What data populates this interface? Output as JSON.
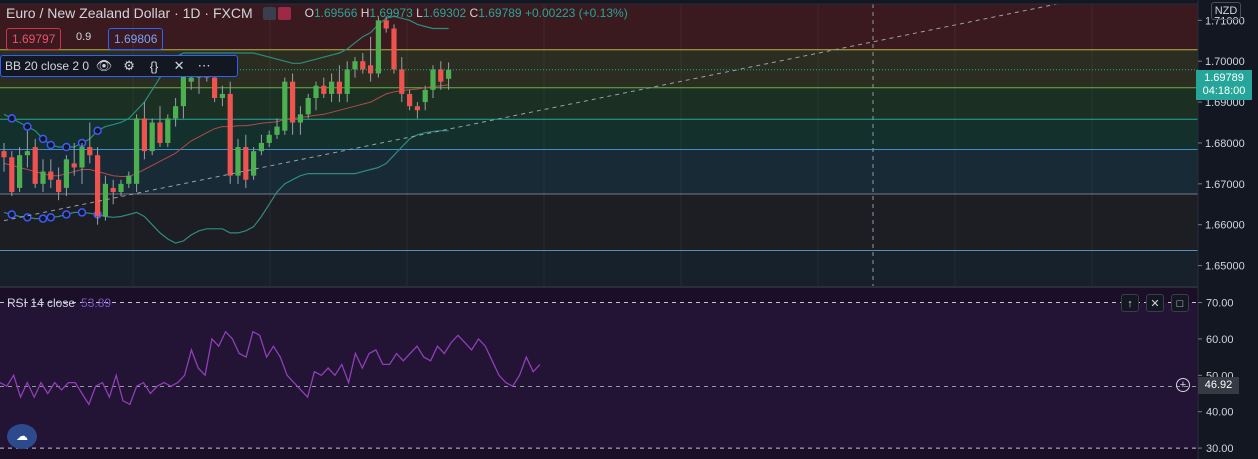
{
  "header": {
    "symbol": "Euro / New Zealand Dollar · 1D · FXCM",
    "open_label": "O",
    "open": "1.69566",
    "high_label": "H",
    "high": "1.69973",
    "low_label": "L",
    "low": "1.69302",
    "close_label": "C",
    "close": "1.69789",
    "change": "+0.00223 (+0.13%)"
  },
  "trade": {
    "sell": "1.69797",
    "spread": "0.9",
    "buy": "1.69806"
  },
  "indicator": {
    "label": "BB 20 close 2 0",
    "icons": [
      "eye-icon",
      "gear-icon",
      "braces-icon",
      "close-icon",
      "more-icon"
    ],
    "icon_glyphs": [
      "👁",
      "⚙",
      "{}",
      "✕",
      "⋯"
    ]
  },
  "axis": {
    "currency": "NZD",
    "price_ticks": [
      "1.71000",
      "1.70000",
      "1.69000",
      "1.68000",
      "1.67000",
      "1.66000",
      "1.65000"
    ],
    "last_price": "1.69789",
    "countdown": "04:18:00",
    "rsi_ticks": [
      "70.00",
      "60.00",
      "50.00",
      "40.00",
      "30.00"
    ],
    "rsi_crosshair": "46.92"
  },
  "rsi": {
    "label": "RSI 14 close",
    "value": "53.89",
    "buttons": [
      "↑",
      "✕",
      "□"
    ]
  },
  "logo": {
    "name": "tradingview-logo-icon"
  },
  "colors": {
    "up": "#26a69a",
    "down": "#ef5350",
    "bb": "#2e8b7f",
    "rsi": "#8e3fb4",
    "bg": "#131722",
    "rsi_bg": "#1a0f26"
  },
  "chart_data": [
    {
      "type": "candlestick",
      "title": "",
      "ylim": [
        1.645,
        1.714
      ],
      "ohlc": [
        [
          1.678,
          1.68,
          1.673,
          1.6765
        ],
        [
          1.6765,
          1.678,
          1.667,
          1.668
        ],
        [
          1.669,
          1.679,
          1.668,
          1.677
        ],
        [
          1.677,
          1.683,
          1.674,
          1.678
        ],
        [
          1.679,
          1.681,
          1.669,
          1.67
        ],
        [
          1.67,
          1.676,
          1.668,
          1.673
        ],
        [
          1.673,
          1.676,
          1.669,
          1.671
        ],
        [
          1.671,
          1.674,
          1.666,
          1.668
        ],
        [
          1.669,
          1.677,
          1.667,
          1.676
        ],
        [
          1.675,
          1.68,
          1.672,
          1.674
        ],
        [
          1.674,
          1.68,
          1.67,
          1.679
        ],
        [
          1.679,
          1.685,
          1.675,
          1.677
        ],
        [
          1.677,
          1.679,
          1.66,
          1.662
        ],
        [
          1.662,
          1.672,
          1.661,
          1.67
        ],
        [
          1.669,
          1.671,
          1.665,
          1.668
        ],
        [
          1.668,
          1.671,
          1.667,
          1.67
        ],
        [
          1.67,
          1.673,
          1.669,
          1.672
        ],
        [
          1.67,
          1.687,
          1.668,
          1.686
        ],
        [
          1.686,
          1.69,
          1.676,
          1.678
        ],
        [
          1.678,
          1.686,
          1.677,
          1.685
        ],
        [
          1.685,
          1.689,
          1.679,
          1.68
        ],
        [
          1.68,
          1.687,
          1.679,
          1.686
        ],
        [
          1.686,
          1.691,
          1.684,
          1.689
        ],
        [
          1.689,
          1.7,
          1.686,
          1.699
        ],
        [
          1.695,
          1.698,
          1.693,
          1.696
        ],
        [
          1.696,
          1.701,
          1.692,
          1.698
        ],
        [
          1.698,
          1.701,
          1.695,
          1.696
        ],
        [
          1.696,
          1.699,
          1.69,
          1.691
        ],
        [
          1.691,
          1.694,
          1.689,
          1.692
        ],
        [
          1.692,
          1.695,
          1.67,
          1.672
        ],
        [
          1.672,
          1.681,
          1.67,
          1.679
        ],
        [
          1.679,
          1.682,
          1.669,
          1.671
        ],
        [
          1.672,
          1.679,
          1.671,
          1.678
        ],
        [
          1.678,
          1.682,
          1.677,
          1.68
        ],
        [
          1.68,
          1.683,
          1.679,
          1.682
        ],
        [
          1.682,
          1.686,
          1.681,
          1.684
        ],
        [
          1.683,
          1.696,
          1.682,
          1.695
        ],
        [
          1.695,
          1.697,
          1.682,
          1.685
        ],
        [
          1.685,
          1.689,
          1.682,
          1.687
        ],
        [
          1.687,
          1.692,
          1.686,
          1.691
        ],
        [
          1.691,
          1.695,
          1.688,
          1.694
        ],
        [
          1.694,
          1.696,
          1.691,
          1.692
        ],
        [
          1.692,
          1.697,
          1.69,
          1.695
        ],
        [
          1.695,
          1.699,
          1.69,
          1.692
        ],
        [
          1.692,
          1.7,
          1.69,
          1.698
        ],
        [
          1.698,
          1.701,
          1.696,
          1.7
        ],
        [
          1.7,
          1.702,
          1.697,
          1.698
        ],
        [
          1.699,
          1.706,
          1.695,
          1.697
        ],
        [
          1.697,
          1.711,
          1.696,
          1.71
        ],
        [
          1.71,
          1.711,
          1.707,
          1.708
        ],
        [
          1.708,
          1.709,
          1.697,
          1.698
        ],
        [
          1.698,
          1.701,
          1.69,
          1.692
        ],
        [
          1.692,
          1.693,
          1.688,
          1.689
        ],
        [
          1.689,
          1.69,
          1.686,
          1.688
        ],
        [
          1.69,
          1.694,
          1.688,
          1.693
        ],
        [
          1.693,
          1.699,
          1.691,
          1.698
        ],
        [
          1.698,
          1.7,
          1.693,
          1.695
        ],
        [
          1.6957,
          1.6997,
          1.693,
          1.6979
        ]
      ],
      "bollinger_upper": [
        1.687,
        1.686,
        1.685,
        1.684,
        1.683,
        1.681,
        1.6795,
        1.679,
        1.679,
        1.679,
        1.68,
        1.681,
        1.683,
        1.684,
        1.6845,
        1.685,
        1.686,
        1.688,
        1.69,
        1.693,
        1.696,
        1.699,
        1.701,
        1.702,
        1.702,
        1.702,
        1.702,
        1.702,
        1.702,
        1.702,
        1.702,
        1.702,
        1.702,
        1.7015,
        1.701,
        1.7005,
        1.7,
        1.6995,
        1.6995,
        1.7,
        1.7005,
        1.701,
        1.7015,
        1.702,
        1.703,
        1.7045,
        1.706,
        1.707,
        1.709,
        1.7105,
        1.711,
        1.7105,
        1.71,
        1.709,
        1.7085,
        1.708,
        1.708,
        1.708
      ],
      "bollinger_middle": [
        1.675,
        1.6745,
        1.674,
        1.6735,
        1.673,
        1.6725,
        1.672,
        1.672,
        1.6725,
        1.673,
        1.6735,
        1.6735,
        1.673,
        1.6725,
        1.672,
        1.6718,
        1.6718,
        1.6725,
        1.6735,
        1.6745,
        1.6755,
        1.6765,
        1.6775,
        1.679,
        1.6805,
        1.6815,
        1.6825,
        1.6835,
        1.684,
        1.684,
        1.6842,
        1.6842,
        1.6845,
        1.6848,
        1.685,
        1.6852,
        1.6858,
        1.686,
        1.6862,
        1.6865,
        1.6868,
        1.687,
        1.6875,
        1.688,
        1.6885,
        1.689,
        1.6895,
        1.69,
        1.691,
        1.692,
        1.6925,
        1.6928,
        1.693,
        1.6932,
        1.6935,
        1.6938,
        1.694,
        1.6942
      ],
      "bollinger_lower": [
        1.663,
        1.6625,
        1.662,
        1.6618,
        1.6615,
        1.6615,
        1.6618,
        1.662,
        1.6625,
        1.663,
        1.663,
        1.6628,
        1.6625,
        1.662,
        1.6618,
        1.662,
        1.6625,
        1.663,
        1.662,
        1.66,
        1.658,
        1.6565,
        1.6555,
        1.656,
        1.6575,
        1.6585,
        1.659,
        1.659,
        1.659,
        1.658,
        1.658,
        1.6585,
        1.6595,
        1.662,
        1.665,
        1.668,
        1.67,
        1.671,
        1.672,
        1.6725,
        1.6725,
        1.6725,
        1.6725,
        1.6725,
        1.6725,
        1.6725,
        1.673,
        1.6735,
        1.674,
        1.675,
        1.677,
        1.679,
        1.681,
        1.682,
        1.6825,
        1.6828,
        1.683,
        1.683
      ],
      "bb_marker_index": [
        8,
        23,
        36,
        51,
        64,
        79,
        92
      ],
      "fib_levels": [
        1.7028,
        1.6935,
        1.6858,
        1.6784,
        1.6675,
        1.6537
      ],
      "trend_line": {
        "start": [
          0,
          1.661
        ],
        "end": [
          135,
          1.714
        ]
      },
      "crosshair_index": 105
    },
    {
      "type": "line",
      "title": "",
      "ylim": [
        27,
        74
      ],
      "values": [
        48,
        47,
        50,
        44,
        48,
        44,
        48,
        45,
        48,
        46,
        48,
        48,
        45,
        42,
        47,
        48,
        44,
        50,
        43,
        42,
        47,
        48,
        45,
        47,
        48,
        47,
        48,
        50,
        57,
        52,
        50,
        60,
        58,
        62,
        60,
        56,
        55,
        62,
        61,
        55,
        58,
        55,
        50,
        48,
        46,
        44,
        51,
        50,
        52,
        50,
        53,
        48,
        56,
        52,
        56,
        57,
        53,
        53,
        56,
        54,
        56,
        58,
        55,
        54,
        58,
        56,
        59,
        61,
        59,
        57,
        60,
        58,
        54,
        50,
        48,
        47,
        50,
        55,
        51,
        53
      ]
    }
  ]
}
